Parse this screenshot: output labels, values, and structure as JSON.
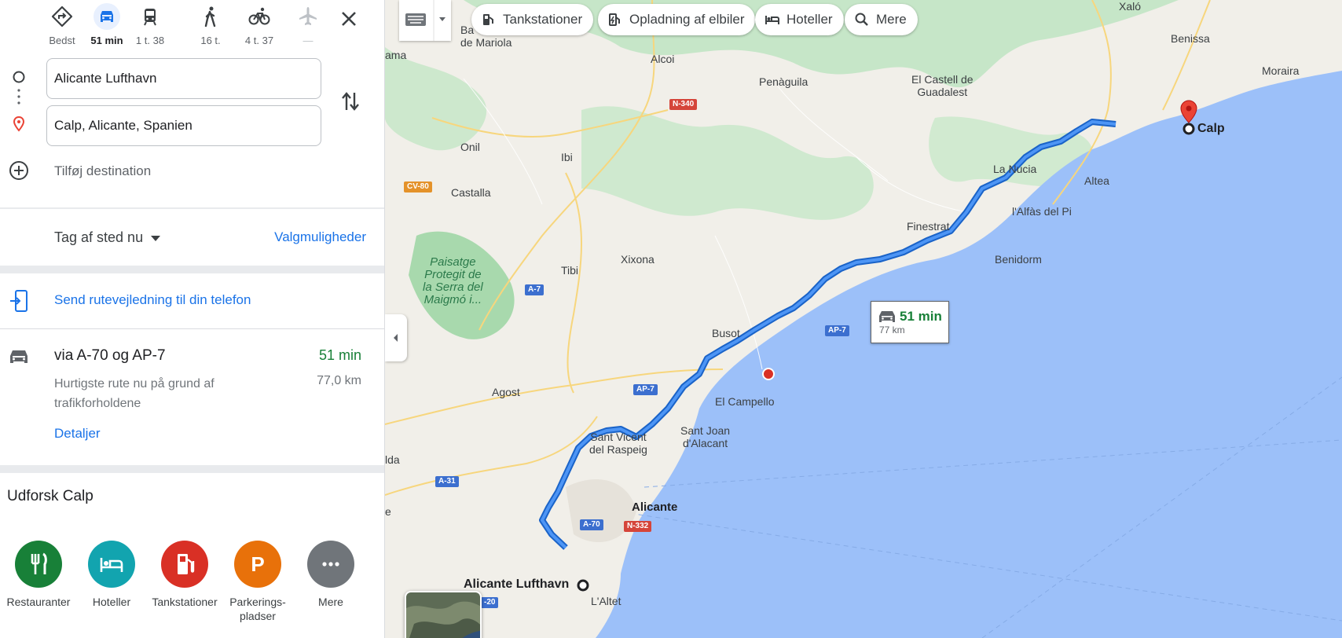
{
  "modes": [
    {
      "id": "best",
      "label": "Bedst",
      "icon": "directions-icon"
    },
    {
      "id": "car",
      "label": "51 min",
      "icon": "car-icon"
    },
    {
      "id": "transit",
      "label": "1 t. 38",
      "icon": "train-icon"
    },
    {
      "id": "walk",
      "label": "16 t.",
      "icon": "walk-icon"
    },
    {
      "id": "bike",
      "label": "4 t. 37",
      "icon": "bike-icon"
    },
    {
      "id": "flight",
      "label": "—",
      "icon": "plane-icon"
    }
  ],
  "route": {
    "origin": "Alicante Lufthavn",
    "destination": "Calp, Alicante, Spanien",
    "add_destination": "Tilføj destination"
  },
  "depart": {
    "label": "Tag af sted nu",
    "options_label": "Valgmuligheder"
  },
  "send_to_phone": "Send rutevejledning til din telefon",
  "route_card": {
    "via": "via A-70 og AP-7",
    "duration": "51 min",
    "description": "Hurtigste rute nu på grund af trafikforholdene",
    "distance": "77,0 km",
    "details": "Detaljer"
  },
  "explore": {
    "title": "Udforsk Calp",
    "categories": [
      {
        "label": "Restauranter",
        "color": "#188038",
        "icon": "restaurant-icon"
      },
      {
        "label": "Hoteller",
        "color": "#12a4af",
        "icon": "hotel-icon"
      },
      {
        "label": "Tankstationer",
        "color": "#d93025",
        "icon": "gas-station-icon"
      },
      {
        "label": "Parkerings-\npladser",
        "color": "#e8710a",
        "icon": "parking-icon"
      },
      {
        "label": "Mere",
        "color": "#70757a",
        "icon": "more-icon"
      }
    ]
  },
  "map": {
    "chips": [
      "Tankstationer",
      "Opladning af elbiler",
      "Hoteller",
      "Mere"
    ],
    "eta": {
      "time": "51 min",
      "distance": "77 km"
    },
    "places": {
      "xalo": "Xaló",
      "benissa": "Benissa",
      "moraira": "Moraira",
      "calp": "Calp",
      "altea": "Altea",
      "la_nucia": "La Nucia",
      "alfas": "l'Alfàs del Pi",
      "finestrat": "Finestrat",
      "benidorm": "Benidorm",
      "castell": "El Castell de\nGuadalest",
      "penaguila": "Penàguila",
      "alcoi": "Alcoi",
      "onil": "Onil",
      "ibi": "Ibi",
      "castalla": "Castalla",
      "tibi": "Tibi",
      "xixona": "Xixona",
      "busot": "Busot",
      "agost": "Agost",
      "campello": "El Campello",
      "sant_joan": "Sant Joan\nd'Alacant",
      "sant_vicent": "Sant Vicent\ndel Raspeig",
      "alicante": "Alicante",
      "airport": "Alicante Lufthavn",
      "altet": "L'Altet",
      "mariola": "Ba\nde Mariola",
      "ama": "ama",
      "lda": "lda",
      "e": "e",
      "paisatge": "Paisatge\nProtegit de\nla Serra del\nMaigmó i..."
    },
    "roads": {
      "n340": "N-340",
      "cv80": "CV-80",
      "a7": "A-7",
      "ap7a": "AP-7",
      "ap7b": "AP-7",
      "a31": "A-31",
      "a70": "A-70",
      "n332": "N-332",
      "a20": "-20"
    },
    "colors": {
      "route": "#1a73e8",
      "land": "#f1efe9",
      "green": "#bfe3c4",
      "sea": "#9cc0f9",
      "marker": "#ea4335"
    }
  }
}
